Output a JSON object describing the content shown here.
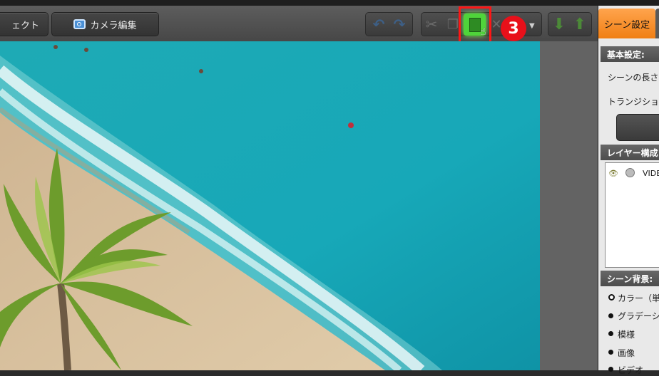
{
  "toolbar": {
    "effect_label": "ェクト",
    "camera_label": "カメラ編集",
    "step_badge": "3"
  },
  "panel": {
    "tab_label": "シーン設定",
    "basic_header": "基本設定:",
    "scene_length_label": "シーンの長さ:",
    "transition_label": "トランジションの",
    "layer_header": "レイヤー構成",
    "layer_item": "VIDE",
    "bg_header": "シーン背景:",
    "bg_options": [
      "カラー（単色",
      "グラデーショ",
      "模様",
      "画像",
      "ビデオ"
    ]
  },
  "icons": {
    "undo": "undo-arrow-icon",
    "redo": "redo-arrow-icon",
    "cut": "scissors-icon",
    "copy": "copy-icon",
    "paste": "paste-icon",
    "delete": "x-delete-icon",
    "move_down": "green-down-arrow-icon",
    "move_up": "green-up-arrow-icon"
  },
  "colors": {
    "highlight": "#ff1515",
    "badge": "#e8101a",
    "active_tab": "#f39022",
    "paste_button": "#4fd43a"
  }
}
